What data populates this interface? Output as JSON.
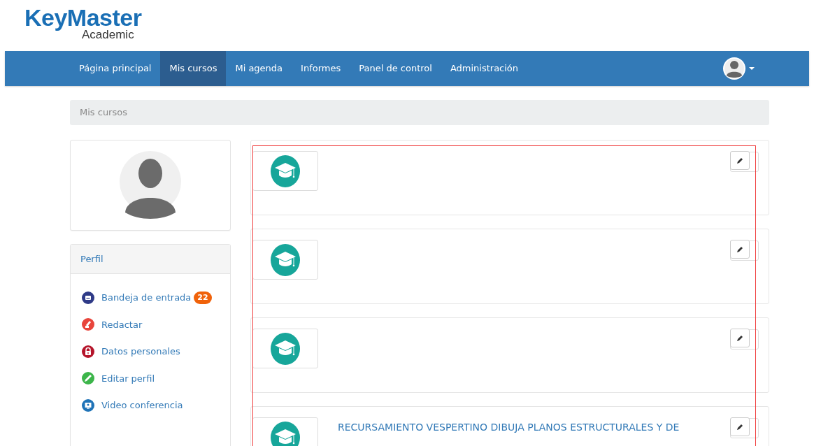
{
  "logo": {
    "name": "KeyMaster",
    "subtitle": "Academic"
  },
  "nav": {
    "items": [
      {
        "label": "Página principal",
        "selected": false
      },
      {
        "label": "Mis cursos",
        "selected": true
      },
      {
        "label": "Mi agenda",
        "selected": false
      },
      {
        "label": "Informes",
        "selected": false
      },
      {
        "label": "Panel de control",
        "selected": false
      },
      {
        "label": "Administración",
        "selected": false
      }
    ]
  },
  "breadcrumb": "Mis cursos",
  "profile_panel": {
    "title": "Perfil",
    "links": [
      {
        "label": "Bandeja de entrada",
        "badge": "22",
        "kind": "inbox",
        "color": "#2e3a87"
      },
      {
        "label": "Redactar",
        "kind": "compose",
        "color": "#e8453c"
      },
      {
        "label": "Datos personales",
        "kind": "lock",
        "color": "#b5152b"
      },
      {
        "label": "Editar perfil",
        "kind": "pencil",
        "color": "#3cb54a"
      },
      {
        "label": "Video conferencia",
        "kind": "video",
        "color": "#1f73b7"
      }
    ]
  },
  "courses": [
    {
      "editable": true
    },
    {
      "editable": true
    },
    {
      "editable": true
    },
    {
      "editable": true,
      "title": "RECURSAMIENTO VESPERTINO DIBUJA PLANOS ESTRUCTURALES Y DE"
    }
  ]
}
